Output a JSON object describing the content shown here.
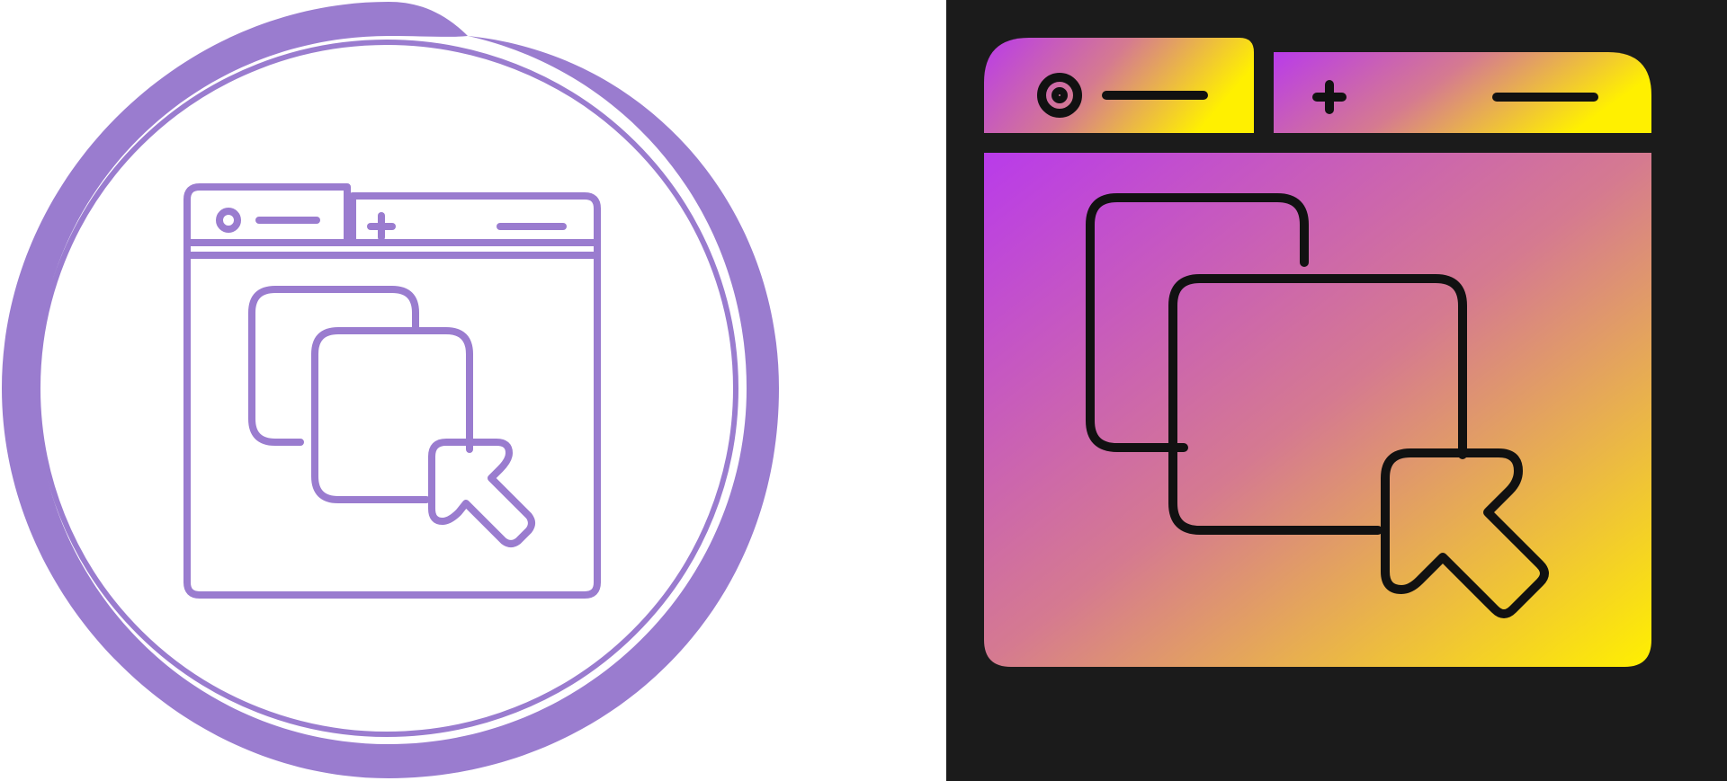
{
  "icons": {
    "left": {
      "name": "browser-tabs-duplicate-icon",
      "style": "outline",
      "stroke_color": "#9A7CCF",
      "background": "#FFFFFF"
    },
    "right": {
      "name": "browser-tabs-duplicate-icon",
      "style": "gradient",
      "background": "#1B1B1B",
      "gradient_start": "#B93BEA",
      "gradient_mid": "#D57A90",
      "gradient_end": "#FFF000",
      "stroke_color": "#111111"
    }
  }
}
